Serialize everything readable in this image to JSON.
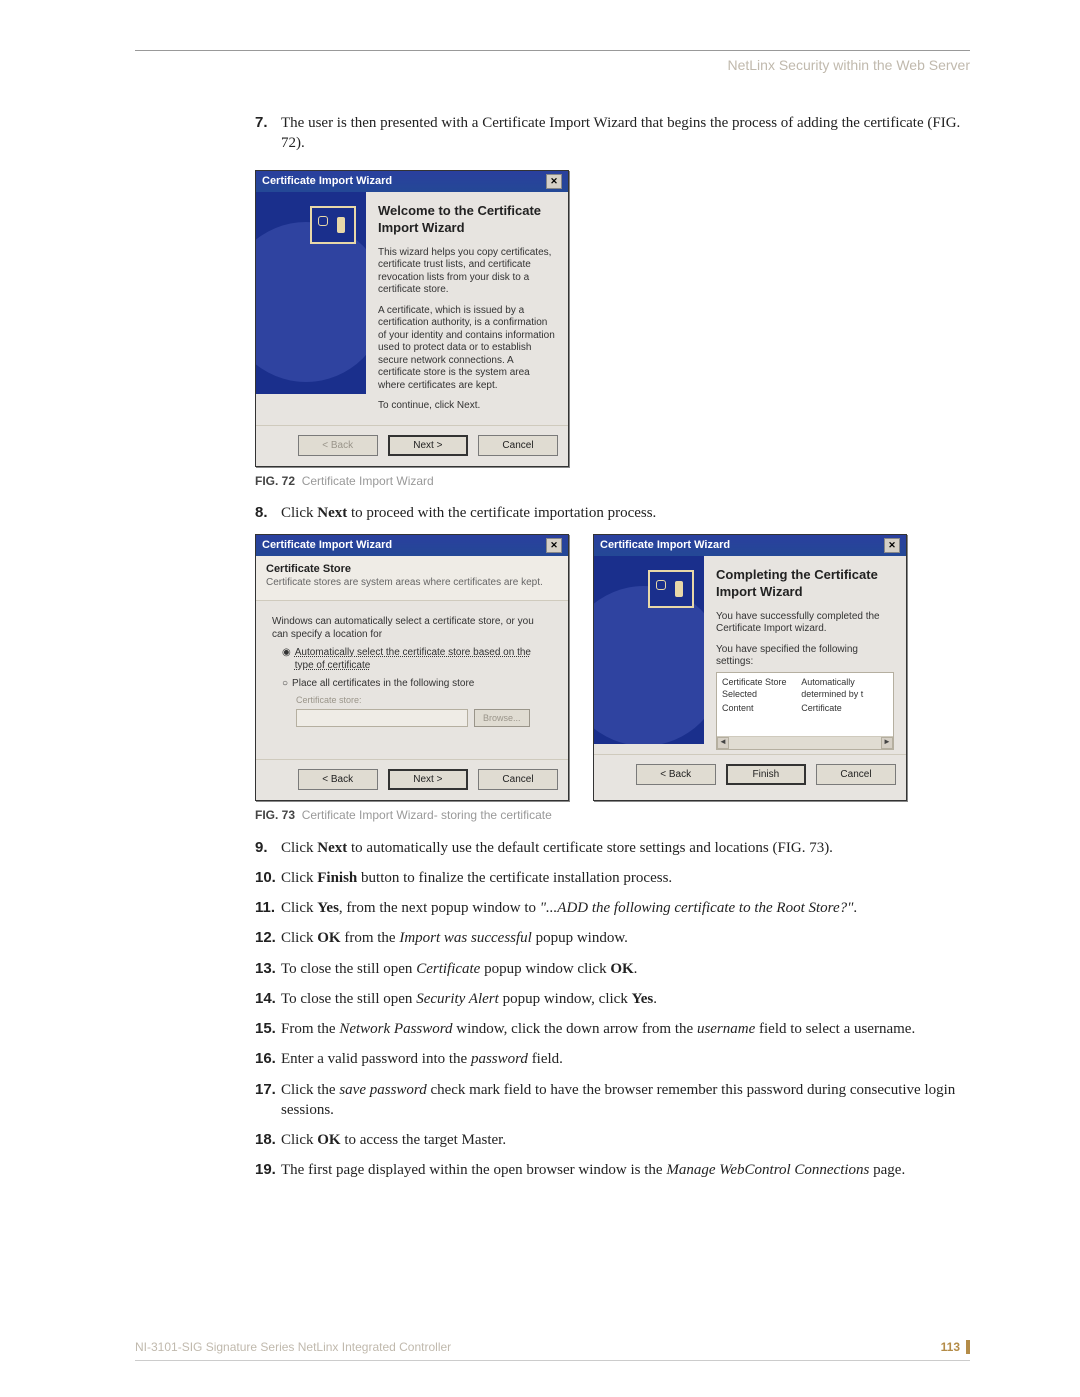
{
  "header": {
    "title": "NetLinx Security within the Web Server"
  },
  "steps_top": {
    "item7": {
      "num": "7.",
      "text": "The user is then presented with a Certificate Import Wizard that begins the process of adding the certificate (FIG. 72)."
    }
  },
  "wizard1": {
    "title": "Certificate Import Wizard",
    "heading": "Welcome to the Certificate Import Wizard",
    "p1": "This wizard helps you copy certificates, certificate trust lists, and certificate revocation lists from your disk to a certificate store.",
    "p2": "A certificate, which is issued by a certification authority, is a confirmation of your identity and contains information used to protect data or to establish secure network connections. A certificate store is the system area where certificates are kept.",
    "p3": "To continue, click Next.",
    "btn_back": "< Back",
    "btn_next": "Next >",
    "btn_cancel": "Cancel"
  },
  "fig72": {
    "label": "FIG. 72",
    "caption": "Certificate Import Wizard"
  },
  "step8": {
    "num": "8.",
    "pre": "Click ",
    "bold": "Next",
    "post": " to proceed with the certificate importation process."
  },
  "wizard2": {
    "title": "Certificate Import Wizard",
    "head_bold": "Certificate Store",
    "head_sub": "Certificate stores are system areas where certificates are kept.",
    "intro": "Windows can automatically select a certificate store, or you can specify a location for",
    "opt1": "Automatically select the certificate store based on the type of certificate",
    "opt2": "Place all certificates in the following store",
    "store_label": "Certificate store:",
    "browse": "Browse...",
    "btn_back": "< Back",
    "btn_next": "Next >",
    "btn_cancel": "Cancel"
  },
  "wizard3": {
    "title": "Certificate Import Wizard",
    "heading": "Completing the Certificate Import Wizard",
    "p1": "You have successfully completed the Certificate Import wizard.",
    "p2": "You have specified the following settings:",
    "row1a": "Certificate Store Selected",
    "row1b": "Automatically determined by t",
    "row2a": "Content",
    "row2b": "Certificate",
    "btn_back": "< Back",
    "btn_finish": "Finish",
    "btn_cancel": "Cancel"
  },
  "fig73": {
    "label": "FIG. 73",
    "caption": "Certificate Import Wizard- storing the certificate"
  },
  "steps_bottom": {
    "s9": {
      "num": "9.",
      "a": "Click ",
      "b": "Next",
      "c": " to automatically use the default certificate store settings and locations (FIG. 73)."
    },
    "s10": {
      "num": "10.",
      "a": "Click ",
      "b": "Finish",
      "c": " button to finalize the certificate installation process."
    },
    "s11": {
      "num": "11.",
      "a": "Click ",
      "b": "Yes",
      "c": ", from the next popup window to ",
      "i": "\"...ADD the following certificate to the Root Store?\"",
      "d": "."
    },
    "s12": {
      "num": "12.",
      "a": "Click ",
      "b": "OK",
      "c": " from the ",
      "i": "Import was successful",
      "d": " popup window."
    },
    "s13": {
      "num": "13.",
      "a": "To close the still open ",
      "i": "Certificate",
      "c": " popup window click ",
      "b": "OK",
      "d": "."
    },
    "s14": {
      "num": "14.",
      "a": "To close the still open ",
      "i": "Security Alert",
      "c": " popup window, click ",
      "b": "Yes",
      "d": "."
    },
    "s15": {
      "num": "15.",
      "a": "From the ",
      "i": "Network Password",
      "c": " window, click the down arrow from the ",
      "i2": "username",
      "d": " field to select a username."
    },
    "s16": {
      "num": "16.",
      "a": "Enter a valid password into the ",
      "i": "password",
      "c": " field."
    },
    "s17": {
      "num": "17.",
      "a": "Click the ",
      "i": "save password",
      "c": " check mark field to have the browser remember this password during consecutive login sessions."
    },
    "s18": {
      "num": "18.",
      "a": "Click ",
      "b": "OK",
      "c": " to access the target Master."
    },
    "s19": {
      "num": "19.",
      "a": "The first page displayed within the open browser window is the ",
      "i": "Manage WebControl Connections",
      "c": " page."
    }
  },
  "footer": {
    "doc": "NI-3101-SIG Signature Series NetLinx Integrated Controller",
    "page": "113"
  }
}
